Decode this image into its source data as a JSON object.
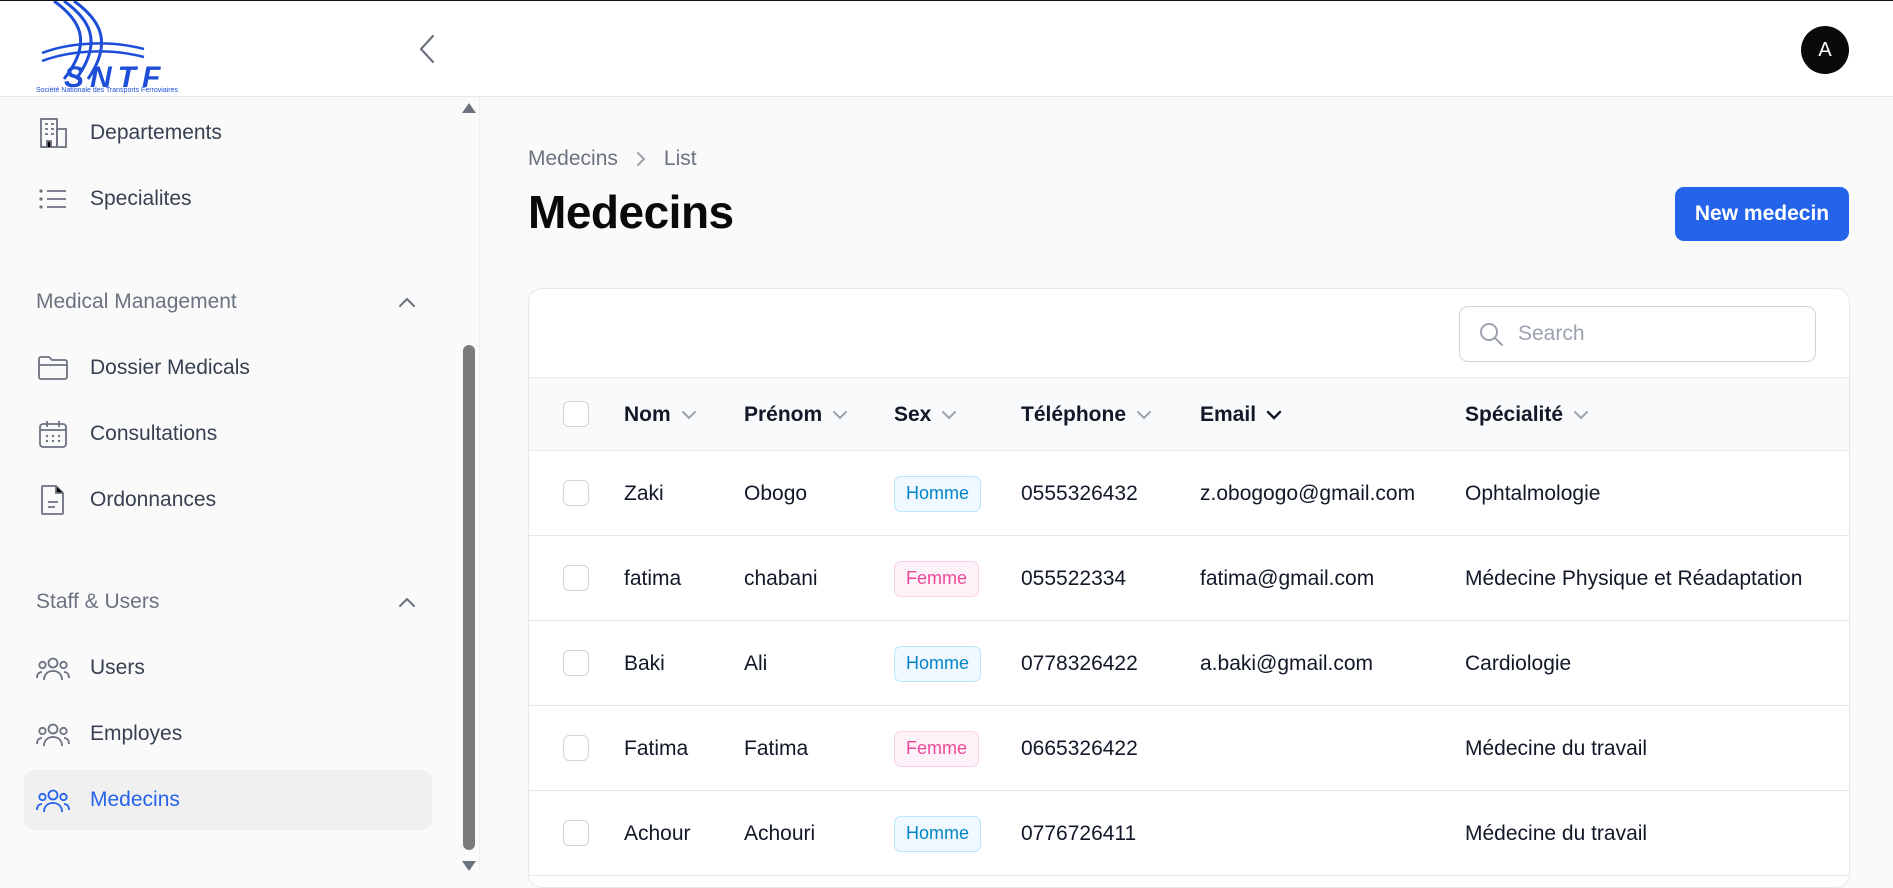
{
  "brand": {
    "name": "SNTF",
    "tagline": "Société Nationale des Transports Ferroviaires",
    "accent": "#2563eb",
    "logo_color": "#1d4ed8"
  },
  "user": {
    "avatar_initial": "A"
  },
  "sidebar": {
    "items_top": [
      {
        "label": "Departements",
        "icon": "building-icon"
      },
      {
        "label": "Specialites",
        "icon": "list-icon"
      }
    ],
    "groups": [
      {
        "title": "Medical Management",
        "items": [
          {
            "label": "Dossier Medicals",
            "icon": "folder-icon"
          },
          {
            "label": "Consultations",
            "icon": "calendar-icon"
          },
          {
            "label": "Ordonnances",
            "icon": "document-icon"
          }
        ]
      },
      {
        "title": "Staff & Users",
        "items": [
          {
            "label": "Users",
            "icon": "users-icon"
          },
          {
            "label": "Employes",
            "icon": "users-icon"
          },
          {
            "label": "Medecins",
            "icon": "users-icon",
            "active": true
          }
        ]
      }
    ]
  },
  "breadcrumb": {
    "parent": "Medecins",
    "current": "List"
  },
  "page": {
    "title": "Medecins",
    "new_button": "New medecin"
  },
  "search": {
    "placeholder": "Search",
    "value": ""
  },
  "table": {
    "columns": [
      "Nom",
      "Prénom",
      "Sex",
      "Téléphone",
      "Email",
      "Spécialité"
    ],
    "sorted_column": "Email",
    "rows": [
      {
        "nom": "Zaki",
        "prenom": "Obogo",
        "sex": "Homme",
        "telephone": "0555326432",
        "email": "z.obogogo@gmail.com",
        "specialite": "Ophtalmologie"
      },
      {
        "nom": "fatima",
        "prenom": "chabani",
        "sex": "Femme",
        "telephone": "055522334",
        "email": "fatima@gmail.com",
        "specialite": "Médecine Physique et Réadaptation"
      },
      {
        "nom": "Baki",
        "prenom": "Ali",
        "sex": "Homme",
        "telephone": "0778326422",
        "email": "a.baki@gmail.com",
        "specialite": "Cardiologie"
      },
      {
        "nom": "Fatima",
        "prenom": "Fatima",
        "sex": "Femme",
        "telephone": "0665326422",
        "email": "",
        "specialite": "Médecine du travail"
      },
      {
        "nom": "Achour",
        "prenom": "Achouri",
        "sex": "Homme",
        "telephone": "0776726411",
        "email": "",
        "specialite": "Médecine du travail"
      }
    ]
  }
}
